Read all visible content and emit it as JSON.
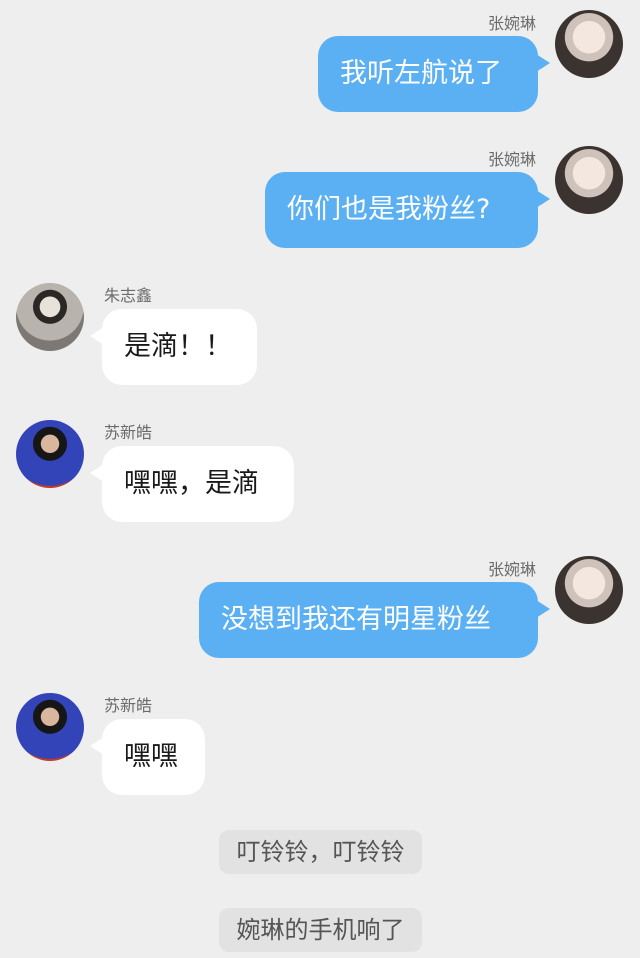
{
  "messages": [
    {
      "sender": "张婉琳",
      "text": "我听左航说了",
      "side": "right",
      "avatar": "girl-avatar"
    },
    {
      "sender": "张婉琳",
      "text": "你们也是我粉丝?",
      "side": "right",
      "avatar": "girl-avatar"
    },
    {
      "sender": "朱志鑫",
      "text": "是滴！！",
      "side": "left",
      "avatar": "zhu-avatar"
    },
    {
      "sender": "苏新皓",
      "text": "嘿嘿，是滴",
      "side": "left",
      "avatar": "su-avatar"
    },
    {
      "sender": "张婉琳",
      "text": "没想到我还有明星粉丝",
      "side": "right",
      "avatar": "girl-avatar"
    },
    {
      "sender": "苏新皓",
      "text": "嘿嘿",
      "side": "left",
      "avatar": "su-avatar"
    }
  ],
  "narrations": [
    "叮铃铃，叮铃铃",
    "婉琳的手机响了"
  ],
  "colors": {
    "background": "#eeeeee",
    "bubble_right": "#5ab0f2",
    "bubble_left": "#ffffff",
    "narration_bg": "#e2e2e2"
  }
}
